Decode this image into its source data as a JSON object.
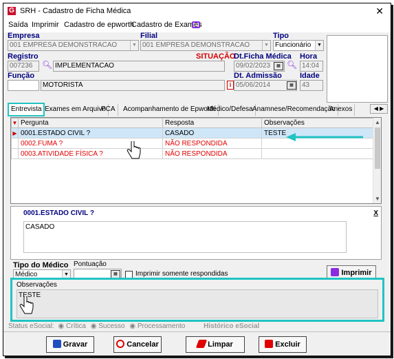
{
  "window": {
    "title": "SRH - Cadastro de Ficha Médica",
    "close": "✕",
    "logo": "G"
  },
  "menu": [
    "Saída",
    "Imprimir",
    "Cadastro de epworth",
    "Cadastro de Exames"
  ],
  "form": {
    "empresa_label": "Empresa",
    "empresa_value": "001 EMPRESA DEMONSTRACAO",
    "filial_label": "Filial",
    "filial_value": "001 EMPRESA DEMONSTRACAO",
    "tipo_label": "Tipo",
    "tipo_value": "Funcionário",
    "registro_label": "Registro",
    "registro_value": "007236",
    "nome_value": "IMPLEMENTACAO",
    "situacao_label": "SITUAÇÃO",
    "dtficha_label": "Dt.Ficha Médica",
    "dtficha_value": "09/02/2023",
    "hora_label": "Hora",
    "hora_value": "14:04",
    "funcao_label": "Função",
    "funcao_value": "MOTORISTA",
    "dtadmissao_label": "Dt. Admissão",
    "dtadmissao_value": "05/06/2014",
    "idade_label": "Idade",
    "idade_value": "43",
    "info_icon": "i"
  },
  "tabs": [
    "Entrevista",
    "Exames em Arquivo",
    "PCA",
    "Acompanhamento de Epworth",
    "Médico/Defesa",
    "Anamnese/Recomendação",
    "Anexos"
  ],
  "grid": {
    "headers": [
      "Pergunta",
      "Resposta",
      "Observações"
    ],
    "rows": [
      {
        "pergunta": "0001.ESTADO CIVIL ?",
        "resposta": "CASADO",
        "obs": "TESTE"
      },
      {
        "pergunta": "0002.FUMA ?",
        "resposta": "NÃO RESPONDIDA",
        "obs": ""
      },
      {
        "pergunta": "0003.ATIVIDADE FÍSICA ?",
        "resposta": "NÃO RESPONDIDA",
        "obs": ""
      }
    ]
  },
  "detail": {
    "question": "0001.ESTADO CIVIL ?",
    "close": "X",
    "answer": "CASADO"
  },
  "options": {
    "tipo_medico_label": "Tipo do Médico",
    "tipo_medico_value": "Médico",
    "pontuacao_label": "Pontuação",
    "imprimir_somente": "Imprimir somente respondidas",
    "imprimir_button": "Imprimir"
  },
  "observacoes": {
    "label": "Observações",
    "value": "TESTE"
  },
  "status": {
    "label": "Status eSocial:",
    "options": [
      "Crítica",
      "Sucesso",
      "Processamento"
    ],
    "historico": "Histórico eSocial"
  },
  "buttons": {
    "gravar": "Gravar",
    "cancelar": "Cancelar",
    "limpar": "Limpar",
    "excluir": "Excluir"
  }
}
